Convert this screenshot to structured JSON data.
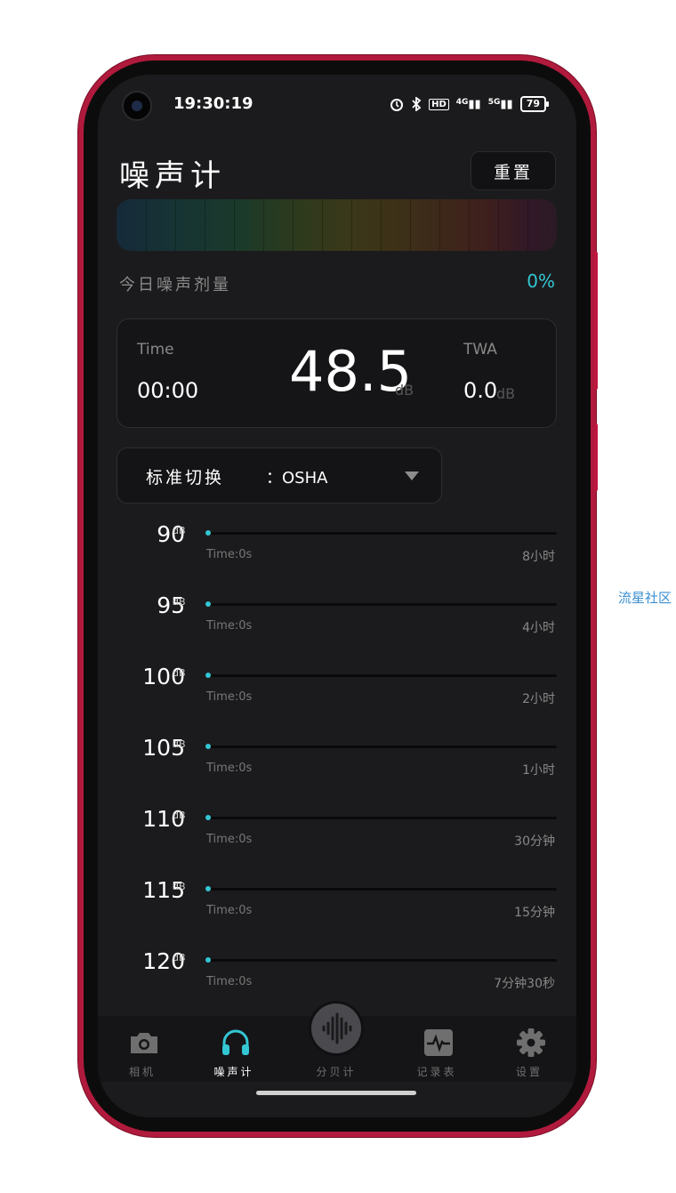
{
  "status_bar": {
    "time": "19:30:19",
    "icons": [
      "alarm-icon",
      "bluetooth-icon",
      "hd-icon",
      "signal-4g-icon",
      "signal-5g-icon"
    ],
    "hd": "HD",
    "net1": "4G",
    "net2": "5G",
    "battery": "79"
  },
  "header": {
    "title": "噪声计",
    "reset_label": "重置"
  },
  "dose": {
    "label": "今日噪声剂量",
    "value": "0%"
  },
  "meter": {
    "time_label": "Time",
    "time_value": "00:00",
    "level": "48.5",
    "level_unit": "dB",
    "twa_label": "TWA",
    "twa_value": "0.0",
    "twa_unit": "dB"
  },
  "standard": {
    "label": "标准切换",
    "value": "：OSHA"
  },
  "levels": [
    {
      "db": "90",
      "unit": "dB",
      "time": "Time:0s",
      "limit": "8小时"
    },
    {
      "db": "95",
      "unit": "dB",
      "time": "Time:0s",
      "limit": "4小时"
    },
    {
      "db": "100",
      "unit": "dB",
      "time": "Time:0s",
      "limit": "2小时"
    },
    {
      "db": "105",
      "unit": "dB",
      "time": "Time:0s",
      "limit": "1小时"
    },
    {
      "db": "110",
      "unit": "dB",
      "time": "Time:0s",
      "limit": "30分钟"
    },
    {
      "db": "115",
      "unit": "dB",
      "time": "Time:0s",
      "limit": "15分钟"
    },
    {
      "db": "120",
      "unit": "dB",
      "time": "Time:0s",
      "limit": "7分钟30秒"
    }
  ],
  "nav": [
    {
      "label": "相机",
      "icon": "camera-icon"
    },
    {
      "label": "噪声计",
      "icon": "headphones-icon",
      "active": true
    },
    {
      "label": "分贝计",
      "icon": "soundwave-icon"
    },
    {
      "label": "记录表",
      "icon": "chart-icon"
    },
    {
      "label": "设置",
      "icon": "gear-icon"
    }
  ],
  "watermark": "流星社区",
  "colors": {
    "accent": "#33c6d4",
    "background": "#1b1b1d",
    "frame": "#b01a3c"
  }
}
